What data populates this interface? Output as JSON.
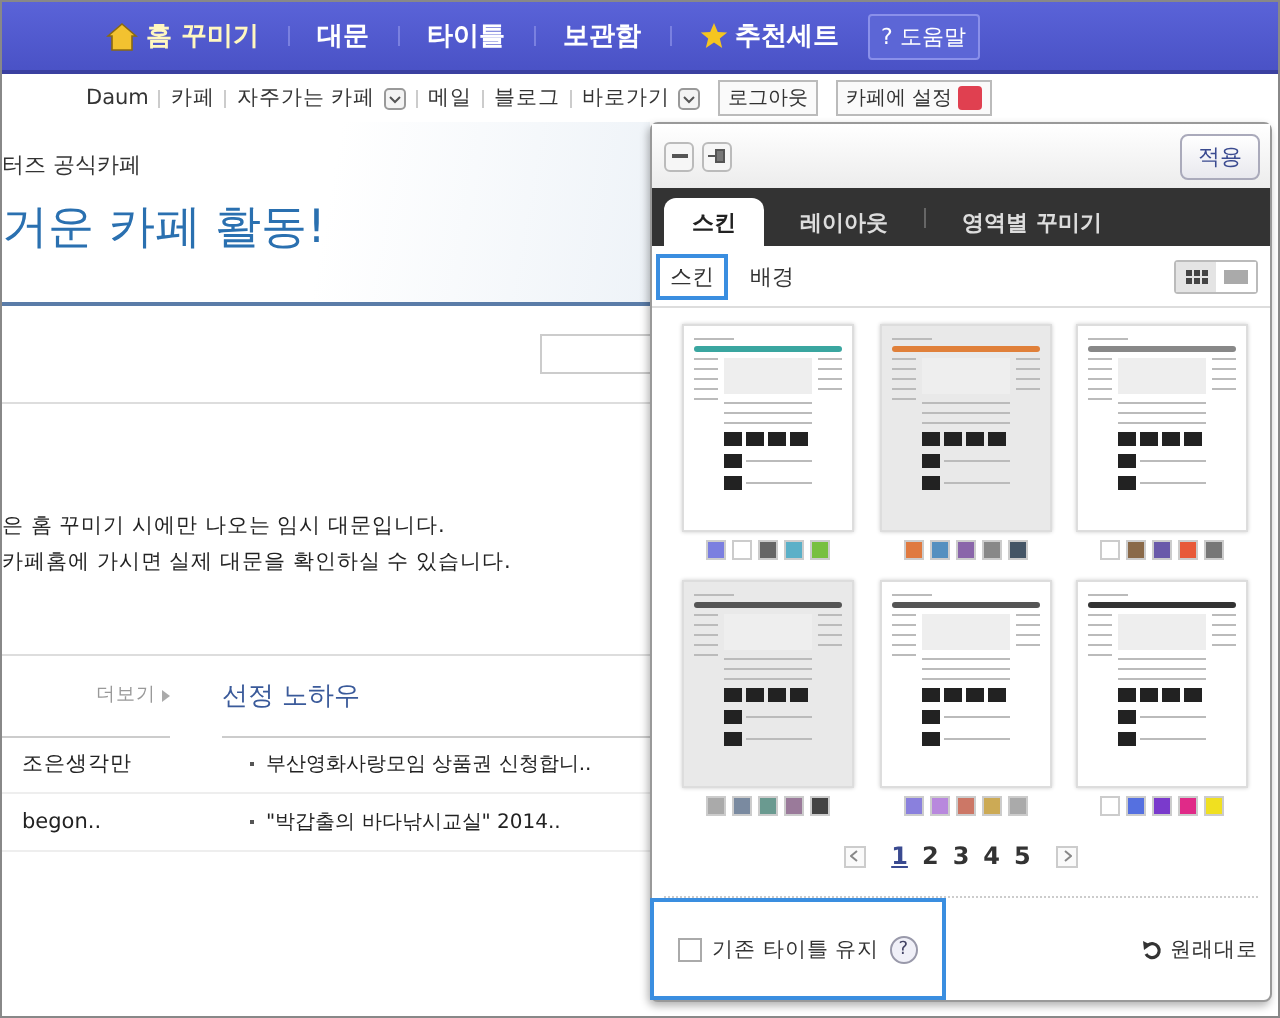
{
  "nav": {
    "items": [
      {
        "label": "홈 꾸미기",
        "kind": "home",
        "selected": true
      },
      {
        "label": "대문",
        "kind": "plain",
        "selected": false
      },
      {
        "label": "타이틀",
        "kind": "plain",
        "selected": false
      },
      {
        "label": "보관함",
        "kind": "plain",
        "selected": false
      },
      {
        "label": "추천세트",
        "kind": "star",
        "selected": false
      }
    ],
    "help_button": {
      "icon_text": "?",
      "label": "도움말"
    }
  },
  "links": [
    {
      "label": "Daum",
      "dropdown": false
    },
    {
      "label": "카페",
      "dropdown": false
    },
    {
      "label": "자주가는 카페",
      "dropdown": true
    },
    {
      "label": "메일",
      "dropdown": false
    },
    {
      "label": "블로그",
      "dropdown": false
    },
    {
      "label": "바로가기",
      "dropdown": true
    }
  ],
  "account_buttons": [
    {
      "label": "로그아웃",
      "badge": false
    },
    {
      "label": "카페에 설정",
      "badge": true
    }
  ],
  "cafe": {
    "subtitle": "터즈 공식카페",
    "title": "거운 카페 활동!",
    "notice": [
      "은 홈 꾸미기 시에만 나오는 임시 대문입니다.",
      " 카페홈에 가시면 실제 대문을 확인하실 수 있습니다."
    ],
    "more_link": "더보기",
    "section_title": "선정 노하우",
    "rows": [
      {
        "author": "조은생각만",
        "title": "부산영화사랑모임 상품권 신청합니.."
      },
      {
        "author": "begon..",
        "title": "\"박갑출의 바다낚시교실\" 2014.."
      }
    ]
  },
  "panel": {
    "apply_button": "적용",
    "tabs": [
      {
        "label": "스킨",
        "selected": true
      },
      {
        "label": "레이아웃",
        "selected": false
      },
      {
        "label": "영역별 꾸미기",
        "selected": false
      }
    ],
    "subtabs": [
      {
        "label": "스킨",
        "selected": true
      },
      {
        "label": "배경",
        "selected": false
      }
    ],
    "view_toggle": [
      {
        "kind": "grid",
        "selected": true
      },
      {
        "kind": "list",
        "selected": false
      }
    ],
    "skins": [
      {
        "color": "#3aa6a0",
        "tinted": false,
        "swatches": [
          {
            "color": "#7b7fe0"
          },
          {
            "color": "#ffffff"
          },
          {
            "color": "#666666"
          },
          {
            "color": "#5bb0c8"
          },
          {
            "color": "#78c040"
          }
        ]
      },
      {
        "color": "#e0803a",
        "tinted": true,
        "swatches": [
          {
            "color": "#e07a40"
          },
          {
            "color": "#5590c0"
          },
          {
            "color": "#8a66aa"
          },
          {
            "color": "#888888"
          },
          {
            "color": "#445566"
          }
        ]
      },
      {
        "color": "#888888",
        "tinted": false,
        "swatches": [
          {
            "color": "#ffffff"
          },
          {
            "color": "#8a6a4a"
          },
          {
            "color": "#6a5aaa"
          },
          {
            "color": "#e85a3a"
          },
          {
            "color": "#777777"
          }
        ]
      },
      {
        "color": "#555555",
        "tinted": true,
        "swatches": [
          {
            "color": "#aaaaaa"
          },
          {
            "color": "#7a8aa0"
          },
          {
            "color": "#6a9a90"
          },
          {
            "color": "#9a7a9a"
          },
          {
            "color": "#444444"
          }
        ]
      },
      {
        "color": "#555555",
        "tinted": false,
        "swatches": [
          {
            "color": "#8a80dd"
          },
          {
            "color": "#b888dd"
          },
          {
            "color": "#cc7766"
          },
          {
            "color": "#ccaa55"
          },
          {
            "color": "#aaaaaa"
          }
        ]
      },
      {
        "color": "#333333",
        "tinted": false,
        "swatches": [
          {
            "color": "#ffffff"
          },
          {
            "color": "#5570e0"
          },
          {
            "color": "#7a3acc"
          },
          {
            "color": "#e02a88"
          },
          {
            "color": "#f0e020"
          }
        ]
      }
    ],
    "pages": [
      {
        "label": "1",
        "selected": true
      },
      {
        "label": "2",
        "selected": false
      },
      {
        "label": "3",
        "selected": false
      },
      {
        "label": "4",
        "selected": false
      },
      {
        "label": "5",
        "selected": false
      }
    ],
    "keep_title": {
      "label": "기존 타이틀 유지",
      "checked": false,
      "help_text": "?"
    },
    "reset_button": "원래대로"
  }
}
